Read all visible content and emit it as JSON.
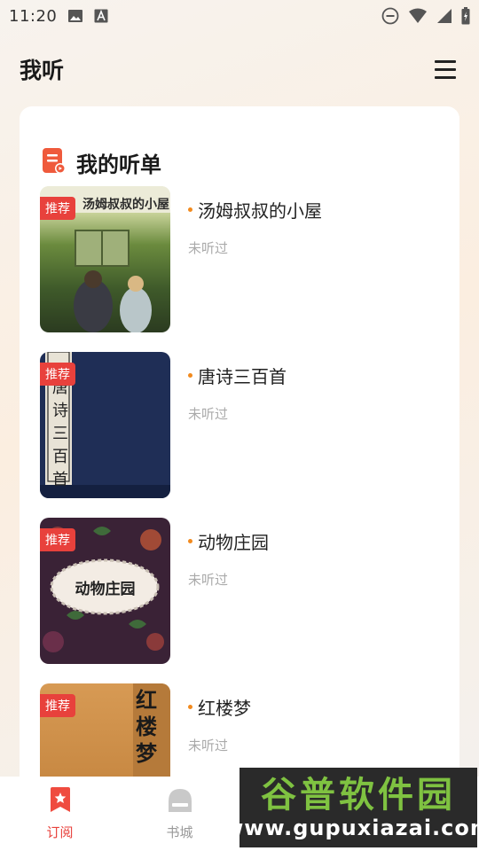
{
  "status_bar": {
    "time": "11:20",
    "icons_left": [
      "gallery-icon",
      "font-a-icon"
    ],
    "icons_right": [
      "do-not-disturb-icon",
      "wifi-icon",
      "cellular-signal-icon",
      "battery-icon"
    ]
  },
  "header": {
    "title": "我听",
    "menu_icon": "hamburger-menu-icon"
  },
  "playlist": {
    "section_title": "我的听单",
    "section_icon": "playlist-icon",
    "books": [
      {
        "badge": "推荐",
        "title": "汤姆叔叔的小屋",
        "status": "未听过",
        "cover_text": "汤姆叔叔的小屋"
      },
      {
        "badge": "推荐",
        "title": "唐诗三百首",
        "status": "未听过",
        "cover_text": "唐诗三百首"
      },
      {
        "badge": "推荐",
        "title": "动物庄园",
        "status": "未听过",
        "cover_text": "动物庄园"
      },
      {
        "badge": "推荐",
        "title": "红楼梦",
        "status": "未听过",
        "cover_text": "红楼梦"
      }
    ]
  },
  "bottom_nav": {
    "items": [
      {
        "label": "订阅",
        "icon": "bookmark-star-icon",
        "active": true
      },
      {
        "label": "书城",
        "icon": "bookstore-icon",
        "active": false
      }
    ]
  },
  "watermark": {
    "title": "谷普软件园",
    "url": "www.gupuxiazai.com"
  },
  "colors": {
    "accent": "#e8413c",
    "dot": "#f28a1e",
    "status_gray": "#aaaaaa"
  }
}
